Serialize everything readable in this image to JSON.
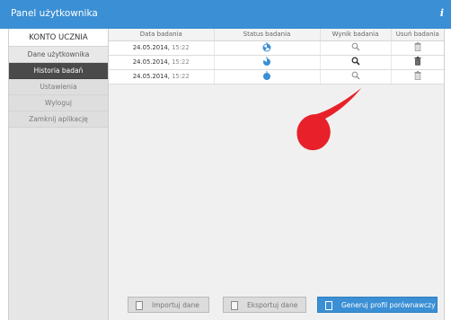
{
  "window": {
    "title": "Panel użytkownika",
    "info_glyph": "i"
  },
  "sidebar": {
    "header": "KONTO UCZNIA",
    "items": [
      {
        "label": "Dane użytkownika"
      },
      {
        "label": "Historia badań"
      },
      {
        "label": "Ustawienia"
      },
      {
        "label": "Wyloguj"
      },
      {
        "label": "Zamknij aplikację"
      }
    ],
    "active_item": "Historia badań"
  },
  "table": {
    "headers": [
      "Data badania",
      "Status badania",
      "Wynik badania",
      "Usuń badania"
    ],
    "rows": [
      {
        "date": "24.05.2014,",
        "time": "15:22",
        "status_icon": "status-partial-icon",
        "result_icon": "magnifier-icon",
        "delete_icon": "trash-icon"
      },
      {
        "date": "24.05.2014,",
        "time": "15:22",
        "status_icon": "status-mostly-icon",
        "result_icon": "magnifier-icon",
        "delete_icon": "trash-icon"
      },
      {
        "date": "24.05.2014,",
        "time": "15:22",
        "status_icon": "status-complete-icon",
        "result_icon": "magnifier-icon",
        "delete_icon": "trash-icon"
      }
    ]
  },
  "buttons": {
    "import": "Importuj dane",
    "export": "Eksportuj dane",
    "generate": "Generuj profil porównawczy"
  },
  "colors": {
    "accent": "#3b8fd4",
    "active_nav": "#4a4a4a",
    "pointer": "#e8202a"
  }
}
